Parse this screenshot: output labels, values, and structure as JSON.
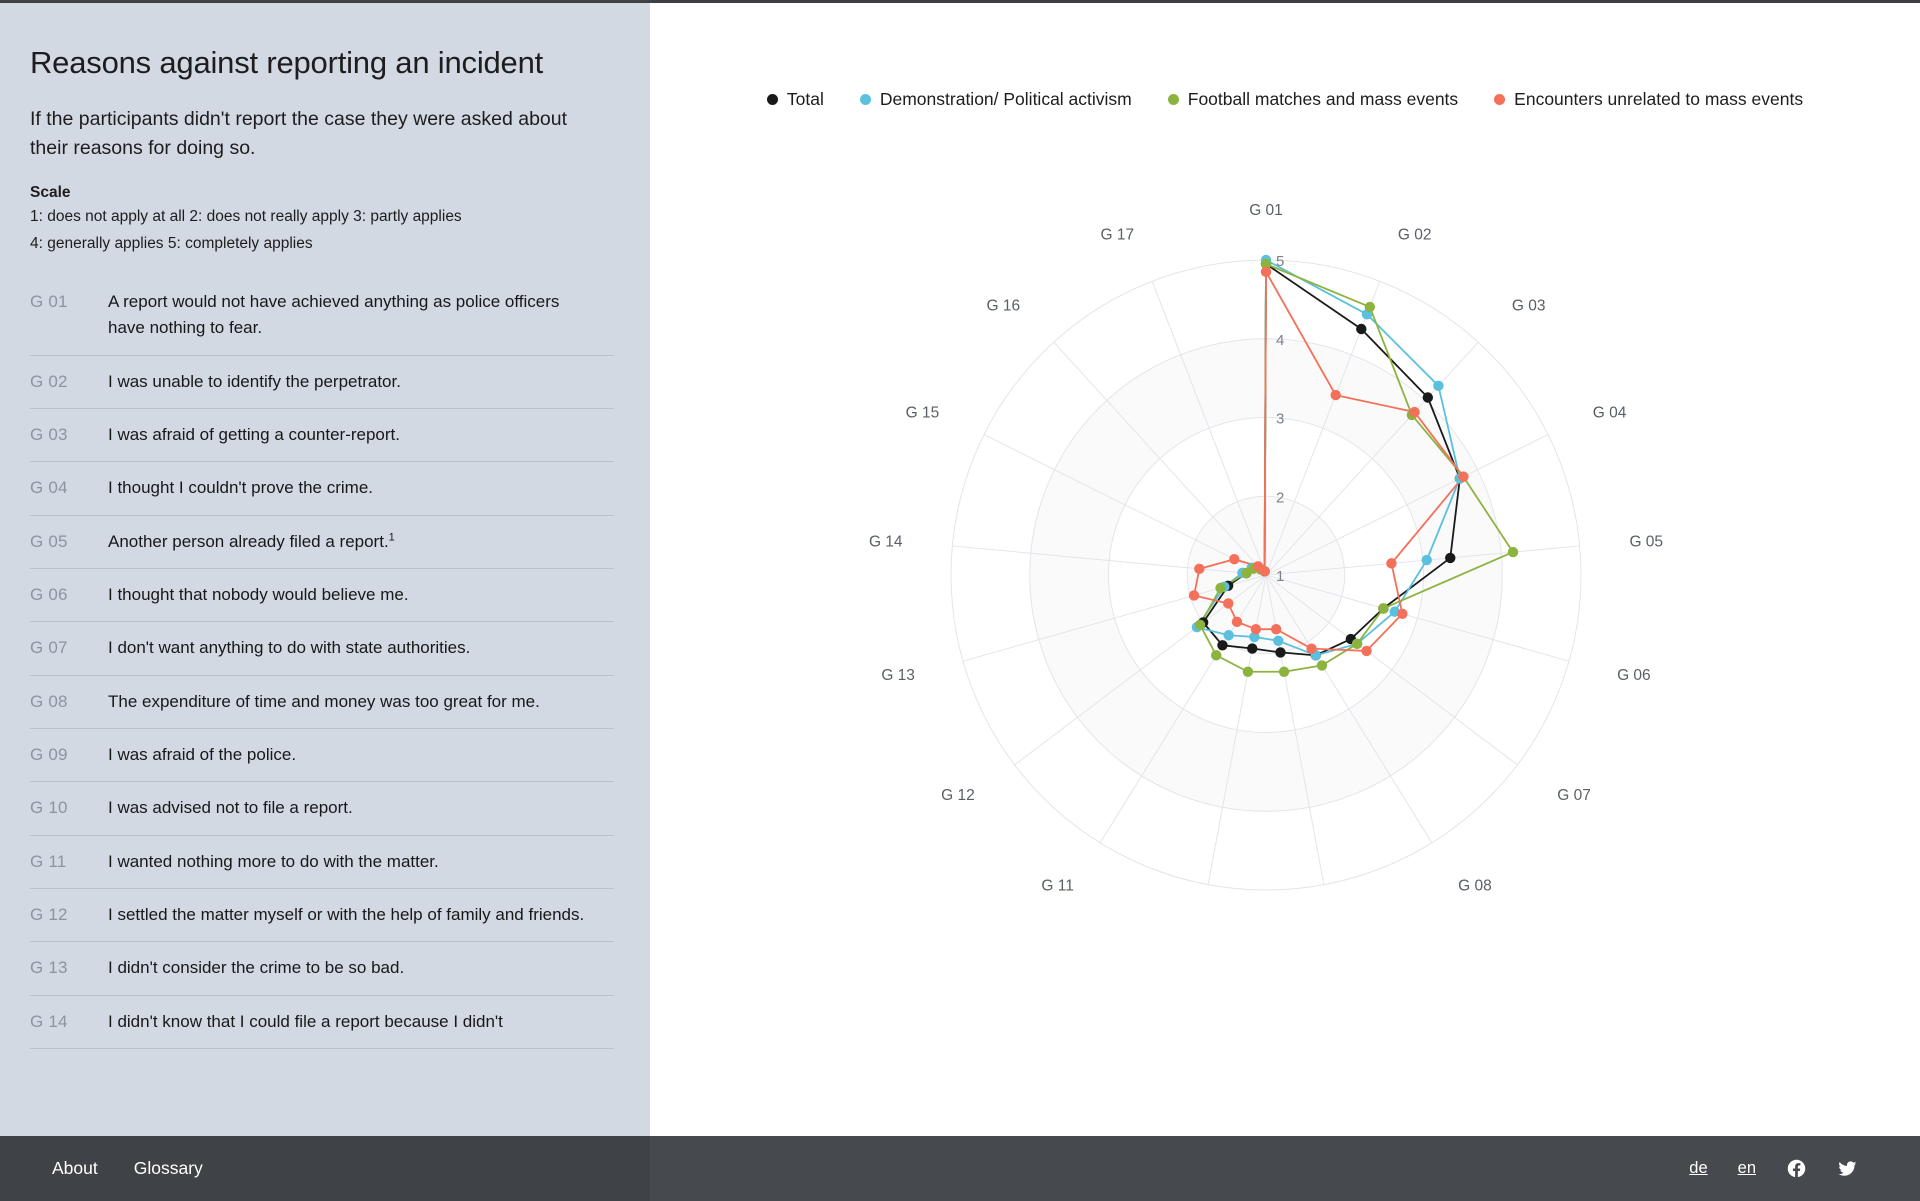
{
  "sidebar": {
    "title": "Reasons against reporting an incident",
    "lede": "If the participants didn't report the case they were asked about their reasons for doing so.",
    "scale_heading": "Scale",
    "scale_line_1": "1: does not apply at all 2: does not really apply 3: partly applies",
    "scale_line_2": "4: generally applies 5: completely applies",
    "items": [
      {
        "code": "G 01",
        "text": "A report would not have achieved anything as police officers have nothing to fear.",
        "sup": ""
      },
      {
        "code": "G 02",
        "text": "I was unable to identify the perpetrator.",
        "sup": ""
      },
      {
        "code": "G 03",
        "text": "I was afraid of getting a counter-report.",
        "sup": ""
      },
      {
        "code": "G 04",
        "text": "I thought I couldn't prove the crime.",
        "sup": ""
      },
      {
        "code": "G 05",
        "text": "Another person already filed a report.",
        "sup": "1"
      },
      {
        "code": "G 06",
        "text": "I thought that nobody would believe me.",
        "sup": ""
      },
      {
        "code": "G 07",
        "text": "I don't want anything to do with state authorities.",
        "sup": ""
      },
      {
        "code": "G 08",
        "text": "The expenditure of time and money was too great for me.",
        "sup": ""
      },
      {
        "code": "G 09",
        "text": "I was afraid of the police.",
        "sup": ""
      },
      {
        "code": "G 10",
        "text": "I was advised not to file a report.",
        "sup": ""
      },
      {
        "code": "G 11",
        "text": "I wanted nothing more to do with the matter.",
        "sup": ""
      },
      {
        "code": "G 12",
        "text": "I settled the matter myself or with the help of family and friends.",
        "sup": ""
      },
      {
        "code": "G 13",
        "text": "I didn't consider the crime to be so bad.",
        "sup": ""
      },
      {
        "code": "G 14",
        "text": "I didn't know that I could file a report because I didn't",
        "sup": ""
      }
    ]
  },
  "footer": {
    "about_label": "About",
    "glossary_label": "Glossary",
    "lang_de": "de",
    "lang_en": "en",
    "facebook_icon": "facebook-icon",
    "twitter_icon": "twitter-icon"
  },
  "chart_data": {
    "type": "line",
    "subtype": "radar",
    "title": "",
    "categories": [
      "G 01",
      "G 02",
      "G 03",
      "G 04",
      "G 05",
      "G 06",
      "G 07",
      "G 08",
      "G 09",
      "G 10",
      "G 11",
      "G 12",
      "G 13",
      "G 14",
      "G 15",
      "G 16",
      "G 17"
    ],
    "rlim": [
      1,
      5
    ],
    "rticks": [
      1,
      2,
      3,
      4,
      5
    ],
    "grid": true,
    "legend_position": "top",
    "series": [
      {
        "name": "Total",
        "color": "#1a1a1a",
        "values": [
          4.95,
          4.35,
          4.05,
          3.75,
          3.35,
          2.55,
          2.35,
          2.2,
          2.0,
          1.95,
          2.05,
          2.0,
          1.5,
          1.25,
          1.2,
          1.1,
          1.05
        ]
      },
      {
        "name": "Demonstration/ Political activism",
        "color": "#5bc0de",
        "values": [
          5.0,
          4.55,
          4.25,
          3.75,
          3.05,
          2.7,
          2.45,
          2.2,
          1.85,
          1.8,
          1.9,
          2.1,
          1.55,
          1.3,
          1.2,
          1.1,
          1.05
        ]
      },
      {
        "name": "Football matches and mass events",
        "color": "#8db33f",
        "values": [
          4.95,
          4.65,
          3.75,
          3.8,
          4.15,
          2.55,
          2.45,
          2.35,
          2.25,
          2.25,
          2.2,
          2.05,
          1.6,
          1.25,
          1.18,
          1.1,
          1.05
        ]
      },
      {
        "name": "Encounters unrelated to mass events",
        "color": "#f4705a",
        "values": [
          4.85,
          3.45,
          3.8,
          3.8,
          2.6,
          2.8,
          2.6,
          2.1,
          1.7,
          1.7,
          1.7,
          1.6,
          1.95,
          1.85,
          1.45,
          1.15,
          1.05
        ]
      }
    ]
  }
}
